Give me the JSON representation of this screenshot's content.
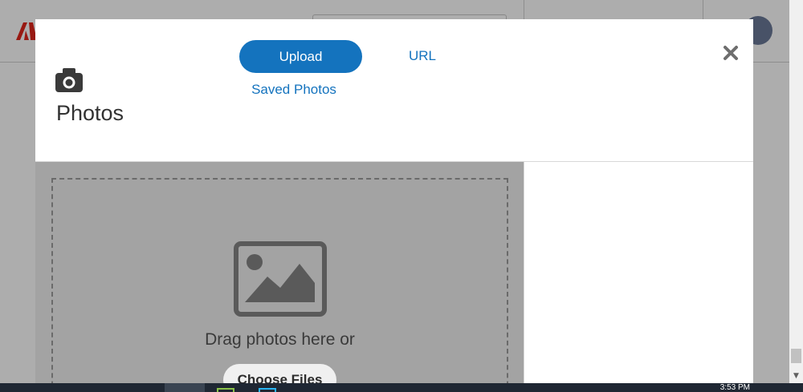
{
  "modal": {
    "title": "Photos",
    "icon": "camera-icon",
    "tabs": {
      "upload_label": "Upload",
      "url_label": "URL",
      "saved_label": "Saved Photos"
    },
    "close_icon": "close-icon",
    "dropzone": {
      "icon": "image-icon",
      "instruction": "Drag photos here or",
      "choose_label": "Choose Files"
    }
  },
  "taskbar": {
    "clock": "3:53 PM"
  },
  "colors": {
    "accent": "#1473be",
    "overlay": "rgba(0,0,0,0.32)",
    "dropzone_bg": "#a3a3a3",
    "brand_red": "#e1251b"
  }
}
